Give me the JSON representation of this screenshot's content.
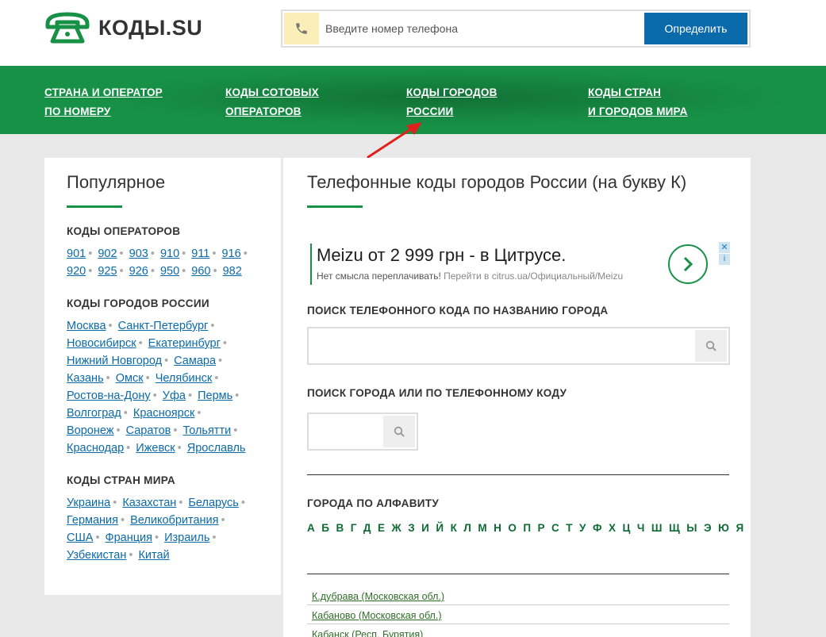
{
  "header": {
    "logo_text": "КОДЫ.SU",
    "phone_placeholder": "Введите номер телефона",
    "determine_button": "Определить"
  },
  "nav": [
    {
      "line1": "СТРАНА И ОПЕРАТОР",
      "line2": "ПО НОМЕРУ"
    },
    {
      "line1": "КОДЫ СОТОВЫХ",
      "line2": "ОПЕРАТОРОВ"
    },
    {
      "line1": "КОДЫ ГОРОДОВ",
      "line2": "РОССИИ"
    },
    {
      "line1": "КОДЫ СТРАН",
      "line2": "И ГОРОДОВ МИРА"
    }
  ],
  "sidebar": {
    "title": "Популярное",
    "operators_title": "КОДЫ ОПЕРАТОРОВ",
    "operator_codes": [
      "901",
      "902",
      "903",
      "910",
      "911",
      "916",
      "920",
      "925",
      "926",
      "950",
      "960",
      "982"
    ],
    "cities_title": "КОДЫ ГОРОДОВ РОССИИ",
    "cities": [
      "Москва",
      "Санкт-Петербург",
      "Новосибирск",
      "Екатеринбург",
      "Нижний Новгород",
      "Самара",
      "Казань",
      "Омск",
      "Челябинск",
      "Ростов-на-Дону",
      "Уфа",
      "Пермь",
      "Волгоград",
      "Красноярск",
      "Воронеж",
      "Саратов",
      "Тольятти",
      "Краснодар",
      "Ижевск",
      "Ярославль"
    ],
    "countries_title": "КОДЫ СТРАН МИРА",
    "countries": [
      "Украина",
      "Казахстан",
      "Беларусь",
      "Германия",
      "Великобритания",
      "США",
      "Франция",
      "Израиль",
      "Узбекистан",
      "Китай"
    ]
  },
  "main": {
    "title": "Телефонные коды городов России (на букву К)",
    "ad": {
      "title": "Meizu от 2 999 грн - в Цитрусе.",
      "sub_main": "Нет смысла переплачивать!",
      "sub_link": "Перейти в citrus.ua/Официальный/Meizu",
      "close": "✕",
      "info": "i"
    },
    "search_by_name_label": "ПОИСК ТЕЛЕФОННОГО КОДА ПО НАЗВАНИЮ ГОРОДА",
    "search_by_code_label": "ПОИСК ГОРОДА ИЛИ ПО ТЕЛЕФОННОМУ КОДУ",
    "alphabet_title": "ГОРОДА ПО АЛФАВИТУ",
    "alphabet": [
      "А",
      "Б",
      "В",
      "Г",
      "Д",
      "Е",
      "Ж",
      "З",
      "И",
      "Й",
      "К",
      "Л",
      "М",
      "Н",
      "О",
      "П",
      "Р",
      "С",
      "Т",
      "У",
      "Ф",
      "Х",
      "Ц",
      "Ч",
      "Ш",
      "Щ",
      "Ы",
      "Э",
      "Ю",
      "Я"
    ],
    "cities": [
      "К.дубрава (Московская обл.)",
      "Кабаново (Московская обл.)",
      "Кабанск (Респ. Бурятия)"
    ]
  }
}
